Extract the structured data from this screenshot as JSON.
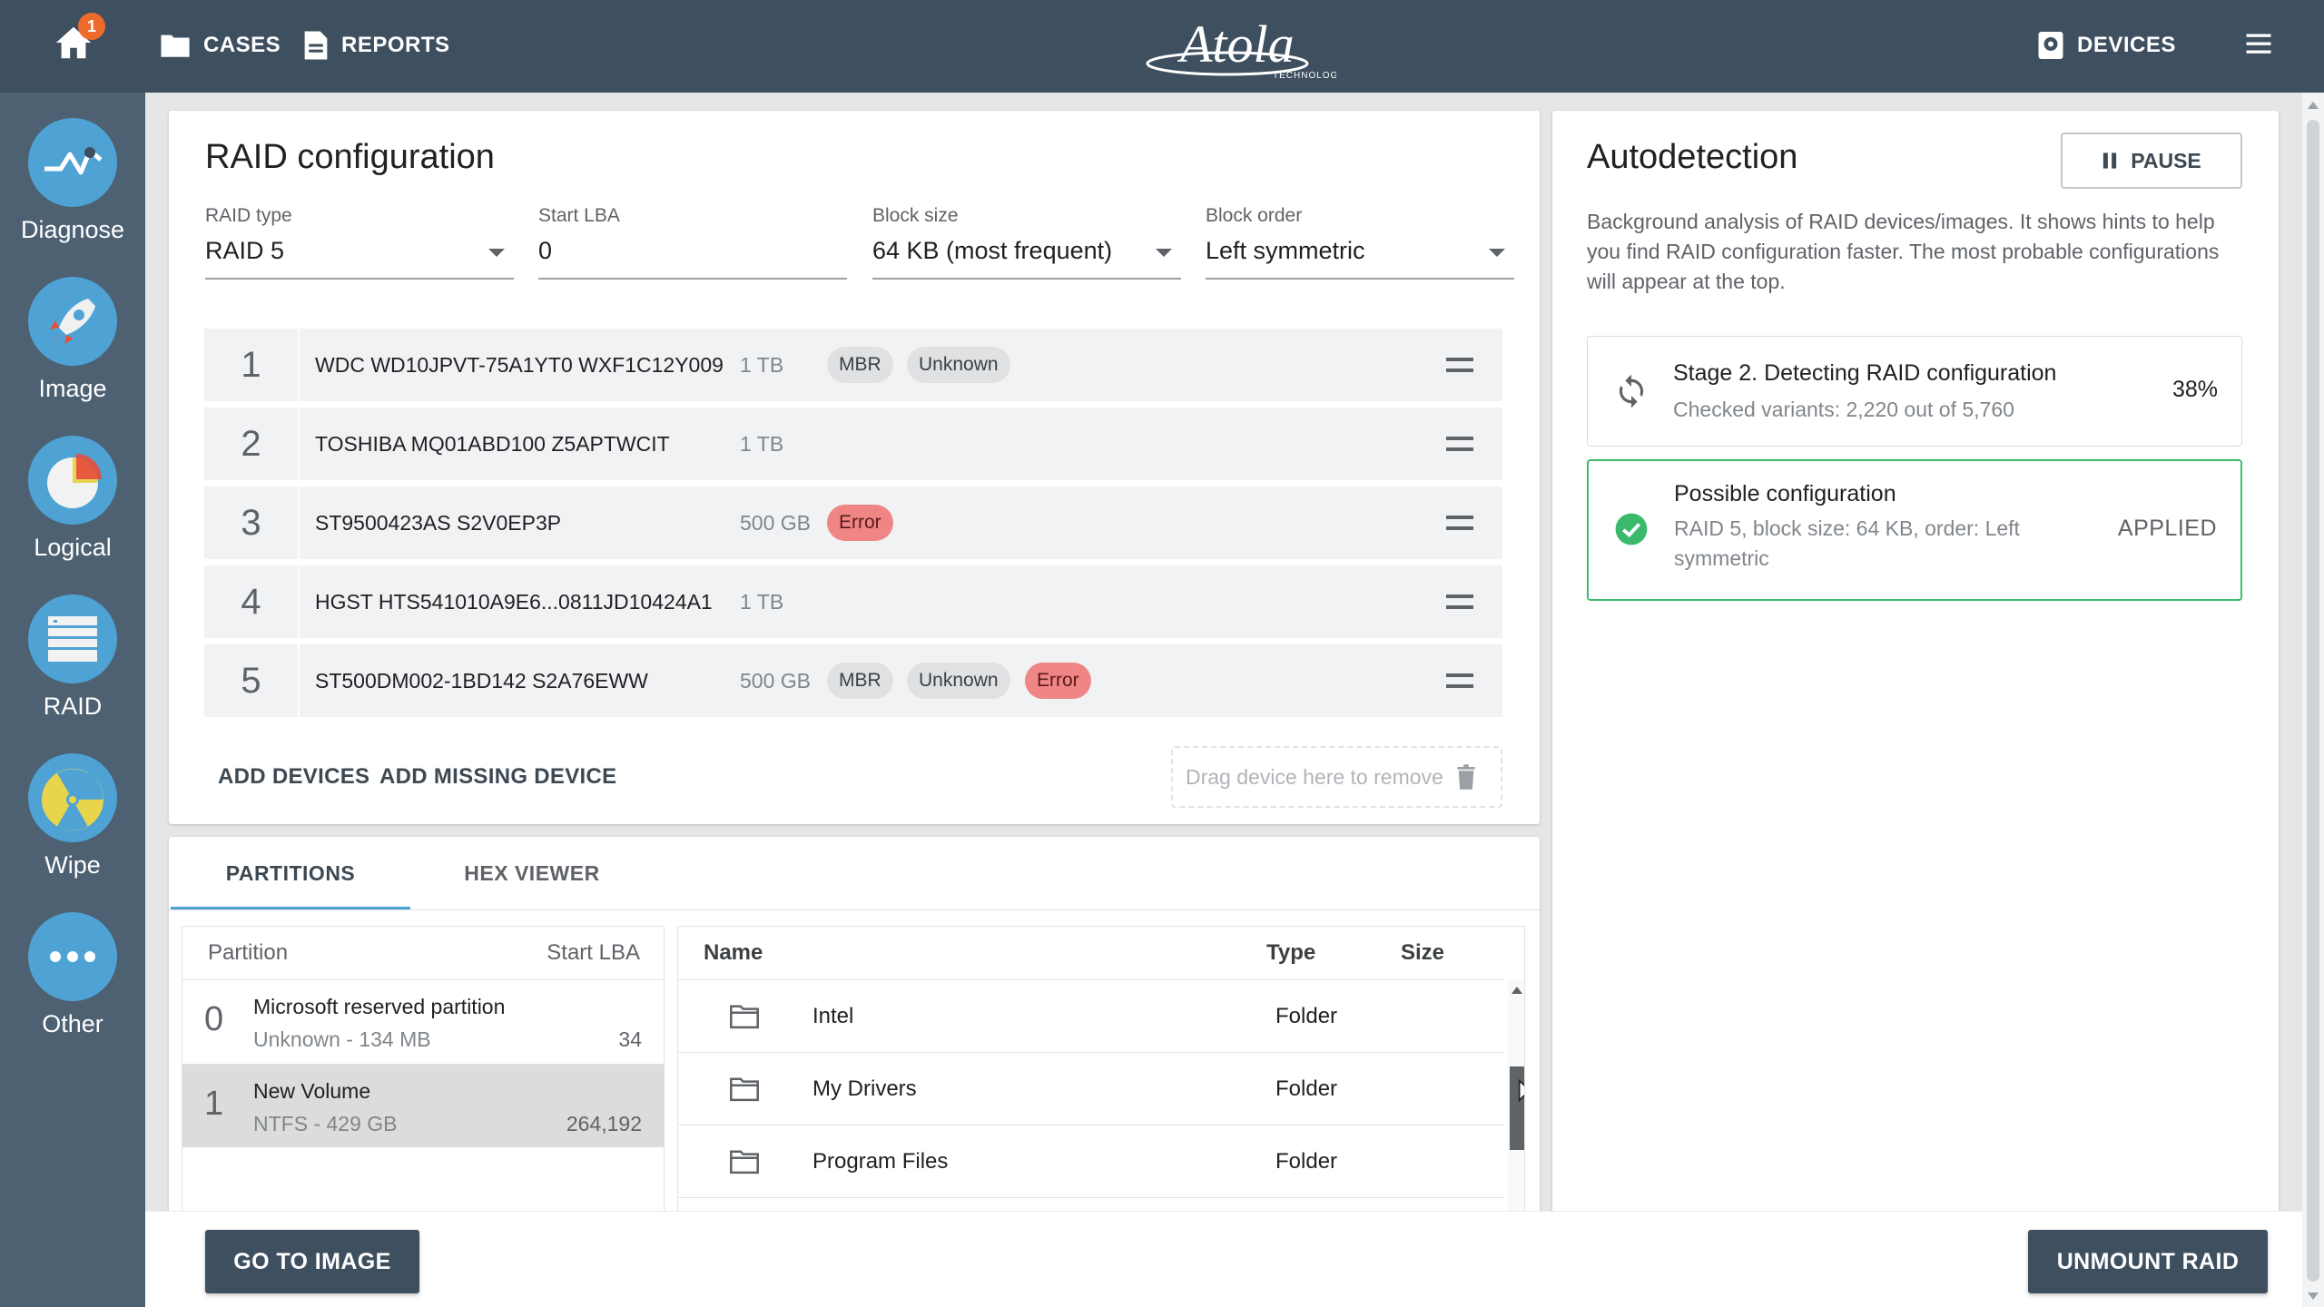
{
  "header": {
    "notification_count": "1",
    "nav": [
      {
        "label": "CASES",
        "icon": "folder-icon"
      },
      {
        "label": "REPORTS",
        "icon": "document-icon"
      }
    ],
    "logo_text": "Atola",
    "logo_sub": "TECHNOLOGY",
    "devices_label": "DEVICES"
  },
  "sidebar": {
    "items": [
      {
        "label": "Diagnose",
        "icon": "diagnose-icon"
      },
      {
        "label": "Image",
        "icon": "rocket-icon"
      },
      {
        "label": "Logical",
        "icon": "pie-chart-icon"
      },
      {
        "label": "RAID",
        "icon": "raid-icon"
      },
      {
        "label": "Wipe",
        "icon": "radiation-icon"
      },
      {
        "label": "Other",
        "icon": "more-icon"
      }
    ]
  },
  "raid": {
    "title": "RAID configuration",
    "fields": [
      {
        "label": "RAID type",
        "value": "RAID 5"
      },
      {
        "label": "Start LBA",
        "value": "0"
      },
      {
        "label": "Block size",
        "value": "64 KB (most frequent)"
      },
      {
        "label": "Block order",
        "value": "Left symmetric"
      }
    ],
    "devices": [
      {
        "num": "1",
        "name": "WDC WD10JPVT-75A1YT0 WXF1C12Y009",
        "size": "1 TB",
        "chips": [
          "MBR",
          "Unknown"
        ]
      },
      {
        "num": "2",
        "name": "TOSHIBA MQ01ABD100 Z5APTWCIT",
        "size": "1 TB",
        "chips": []
      },
      {
        "num": "3",
        "name": "ST9500423AS S2V0EP3P",
        "size": "500 GB",
        "chips": [
          "Error"
        ]
      },
      {
        "num": "4",
        "name": "HGST HTS541010A9E6...0811JD10424A1",
        "size": "1 TB",
        "chips": []
      },
      {
        "num": "5",
        "name": "ST500DM002-1BD142 S2A76EWW",
        "size": "500 GB",
        "chips": [
          "MBR",
          "Unknown",
          "Error"
        ]
      }
    ],
    "add_devices": "ADD DEVICES",
    "add_missing": "ADD MISSING DEVICE",
    "drop_hint": "Drag device here to remove"
  },
  "tabs": {
    "partitions": "PARTITIONS",
    "hex": "HEX VIEWER"
  },
  "partitions": {
    "col_partition": "Partition",
    "col_start": "Start LBA",
    "rows": [
      {
        "idx": "0",
        "name": "Microsoft reserved partition",
        "sub": "Unknown - 134 MB",
        "lba": "34"
      },
      {
        "idx": "1",
        "name": "New Volume",
        "sub": "NTFS - 429 GB",
        "lba": "264,192"
      }
    ]
  },
  "files": {
    "col_name": "Name",
    "col_type": "Type",
    "col_size": "Size",
    "rows": [
      {
        "name": "Intel",
        "type": "Folder"
      },
      {
        "name": "My Drivers",
        "type": "Folder"
      },
      {
        "name": "Program Files",
        "type": "Folder"
      }
    ]
  },
  "autodetect": {
    "title": "Autodetection",
    "pause": "PAUSE",
    "description": "Background analysis of RAID devices/images. It shows hints to help you find RAID configuration faster. The most probable configurations will appear at the top.",
    "stage_title": "Stage 2. Detecting RAID configuration",
    "stage_sub": "Checked variants: 2,220 out of 5,760",
    "stage_percent": "38%",
    "config_title": "Possible configuration",
    "config_sub": "RAID 5, block size: 64 KB, order: Left symmetric",
    "config_status": "APPLIED"
  },
  "footer": {
    "go_to_image": "GO TO IMAGE",
    "unmount": "UNMOUNT RAID"
  },
  "colors": {
    "topbar": "#3e4f5f",
    "sidebar": "#4d6173",
    "accent": "#4ea3d4",
    "success": "#3cba6c",
    "error_chip": "#f08585"
  }
}
